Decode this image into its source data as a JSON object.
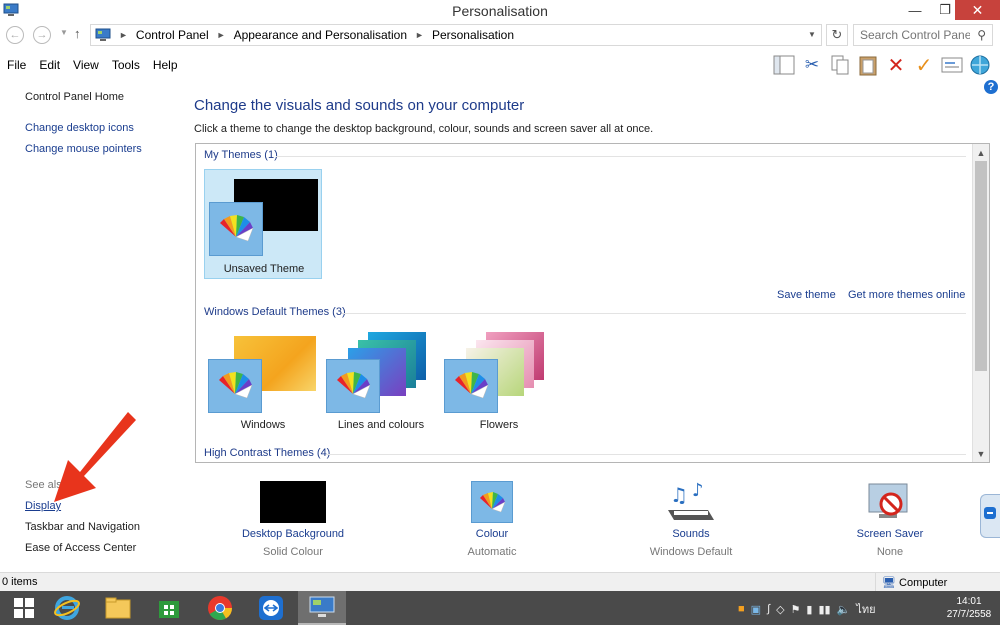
{
  "window": {
    "title": "Personalisation",
    "minimize": "—",
    "maximize": "❐",
    "close": "✕"
  },
  "addressbar": {
    "breadcrumbs": [
      "Control Panel",
      "Appearance and Personalisation",
      "Personalisation"
    ],
    "search_placeholder": "Search Control Panel"
  },
  "menu": [
    "File",
    "Edit",
    "View",
    "Tools",
    "Help"
  ],
  "toolbar_icons": [
    "layout-icon",
    "cut-icon",
    "copy-icon",
    "paste-icon",
    "delete-icon",
    "checkmark-icon",
    "rename-icon",
    "network-icon"
  ],
  "left_pane": {
    "home": "Control Panel Home",
    "links": [
      "Change desktop icons",
      "Change mouse pointers"
    ],
    "see_also_label": "See also",
    "see_also": [
      "Display",
      "Taskbar and Navigation",
      "Ease of Access Center"
    ]
  },
  "main": {
    "heading": "Change the visuals and sounds on your computer",
    "description": "Click a theme to change the desktop background, colour, sounds and screen saver all at once.",
    "my_themes": {
      "header": "My Themes (1)",
      "items": [
        {
          "label": "Unsaved Theme",
          "selected": true
        }
      ],
      "save_link": "Save theme",
      "more_link": "Get more themes online"
    },
    "default_themes": {
      "header": "Windows Default Themes (3)",
      "items": [
        {
          "label": "Windows"
        },
        {
          "label": "Lines and colours"
        },
        {
          "label": "Flowers"
        }
      ]
    },
    "high_contrast": {
      "header": "High Contrast Themes (4)"
    }
  },
  "settings": [
    {
      "name": "Desktop Background",
      "value": "Solid Colour"
    },
    {
      "name": "Colour",
      "value": "Automatic"
    },
    {
      "name": "Sounds",
      "value": "Windows Default"
    },
    {
      "name": "Screen Saver",
      "value": "None"
    }
  ],
  "status": {
    "items": "0 items",
    "location": "Computer"
  },
  "taskbar": {
    "apps": [
      "start-icon",
      "internet-explorer-icon",
      "file-explorer-icon",
      "store-icon",
      "chrome-icon",
      "teamviewer-icon",
      "control-panel-icon"
    ],
    "language": "ไทย",
    "time": "14:01",
    "date": "27/7/2558"
  },
  "colors": {
    "link": "#1a3d8f",
    "heading": "#1e3b8a",
    "close": "#c7423c",
    "taskbar": "#4a4a4a",
    "arrow": "#e8341c"
  }
}
